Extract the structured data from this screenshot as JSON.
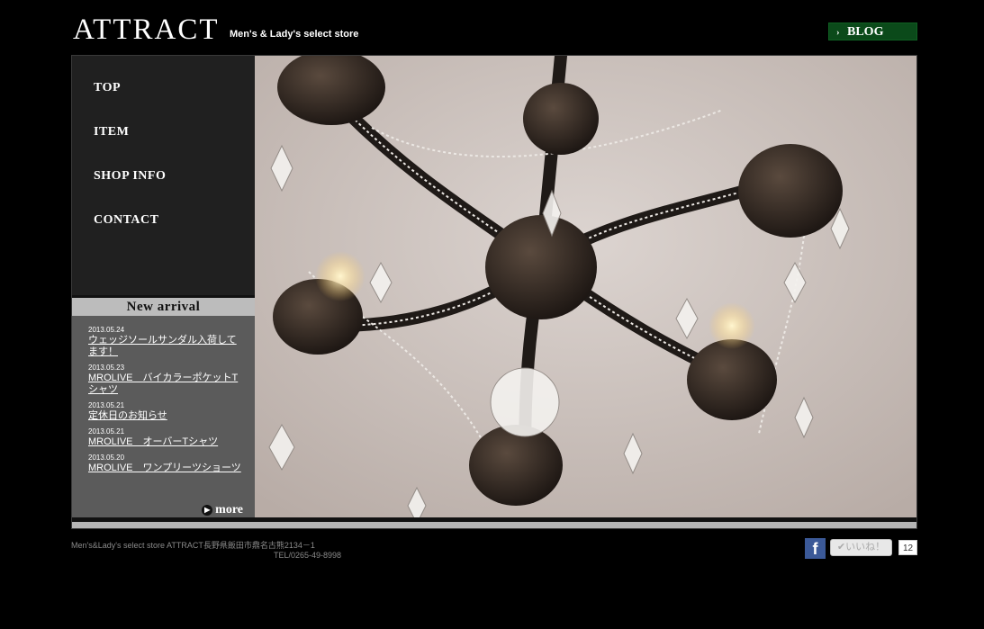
{
  "header": {
    "logo": "ATTRACT",
    "tagline": "Men's & Lady's select store",
    "blog_label": "BLOG"
  },
  "nav": {
    "items": [
      {
        "label": "TOP"
      },
      {
        "label": "ITEM"
      },
      {
        "label": "SHOP INFO"
      },
      {
        "label": "CONTACT"
      }
    ]
  },
  "new_arrival": {
    "heading": "New arrival",
    "entries": [
      {
        "date": "2013.05.24",
        "title": "ウェッジソールサンダル入荷してます！"
      },
      {
        "date": "2013.05.23",
        "title": "MROLIVE　バイカラーポケットTシャツ"
      },
      {
        "date": "2013.05.21",
        "title": "定休日のお知らせ"
      },
      {
        "date": "2013.05.21",
        "title": "MROLIVE　オーバーTシャツ"
      },
      {
        "date": "2013.05.20",
        "title": "MROLIVE　ワンプリーツショーツ"
      }
    ],
    "more_label": "more"
  },
  "footer": {
    "address": "Men's&Lady's select store ATTRACT長野県飯田市鼎名古熊2134－1",
    "tel": "TEL/0265-49-8998",
    "like_label": "✔いいね！",
    "like_count": "12"
  },
  "colors": {
    "background": "#000000",
    "blog_button": "#0b4a1a",
    "nav_bg": "#202020",
    "panel_bg": "#5b5b5b"
  }
}
